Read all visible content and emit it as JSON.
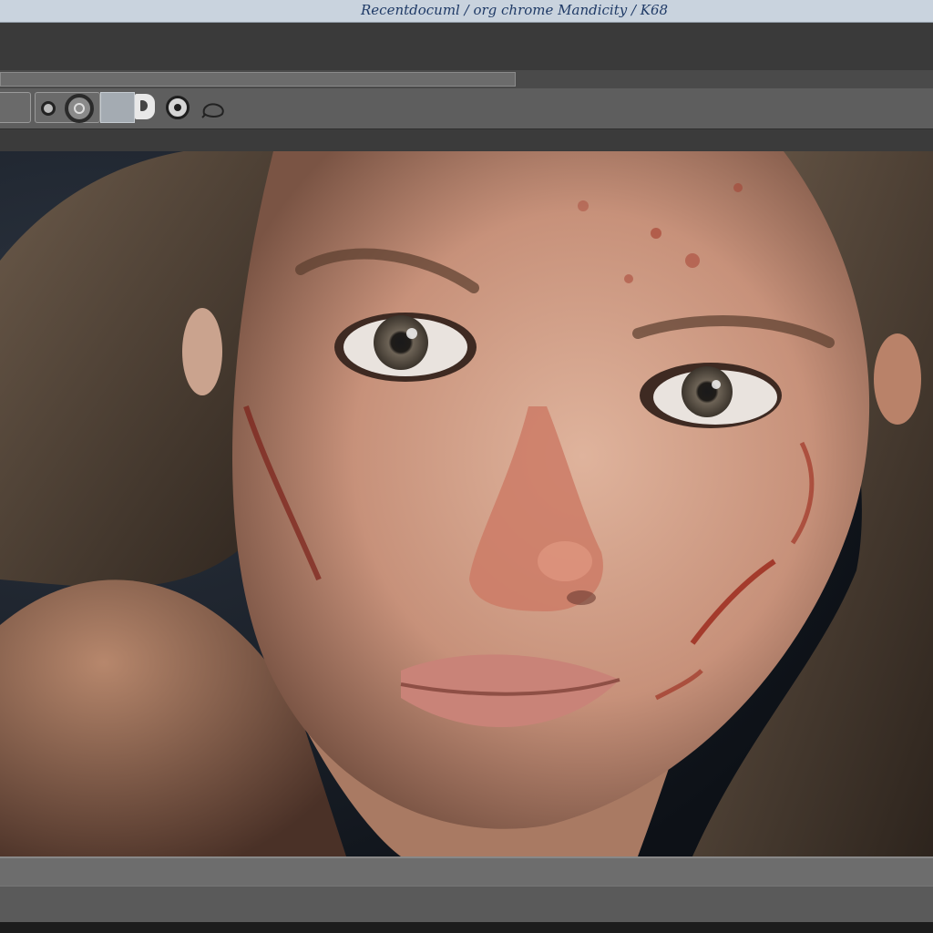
{
  "window": {
    "title": "Recentdocuml / org chrome Mandicity / K68"
  },
  "toolbar": {
    "tools": [
      {
        "icon": "panel-icon"
      },
      {
        "icon": "camera-icon"
      },
      {
        "icon": "swatch-icon"
      },
      {
        "icon": "lens-icon"
      },
      {
        "icon": "lasso-icon"
      }
    ]
  },
  "canvas": {
    "content": "portrait-photo"
  },
  "colors": {
    "titlebar": "#c9d3de",
    "chrome": "#5e5e5e",
    "dark": "#3a3a3a"
  }
}
